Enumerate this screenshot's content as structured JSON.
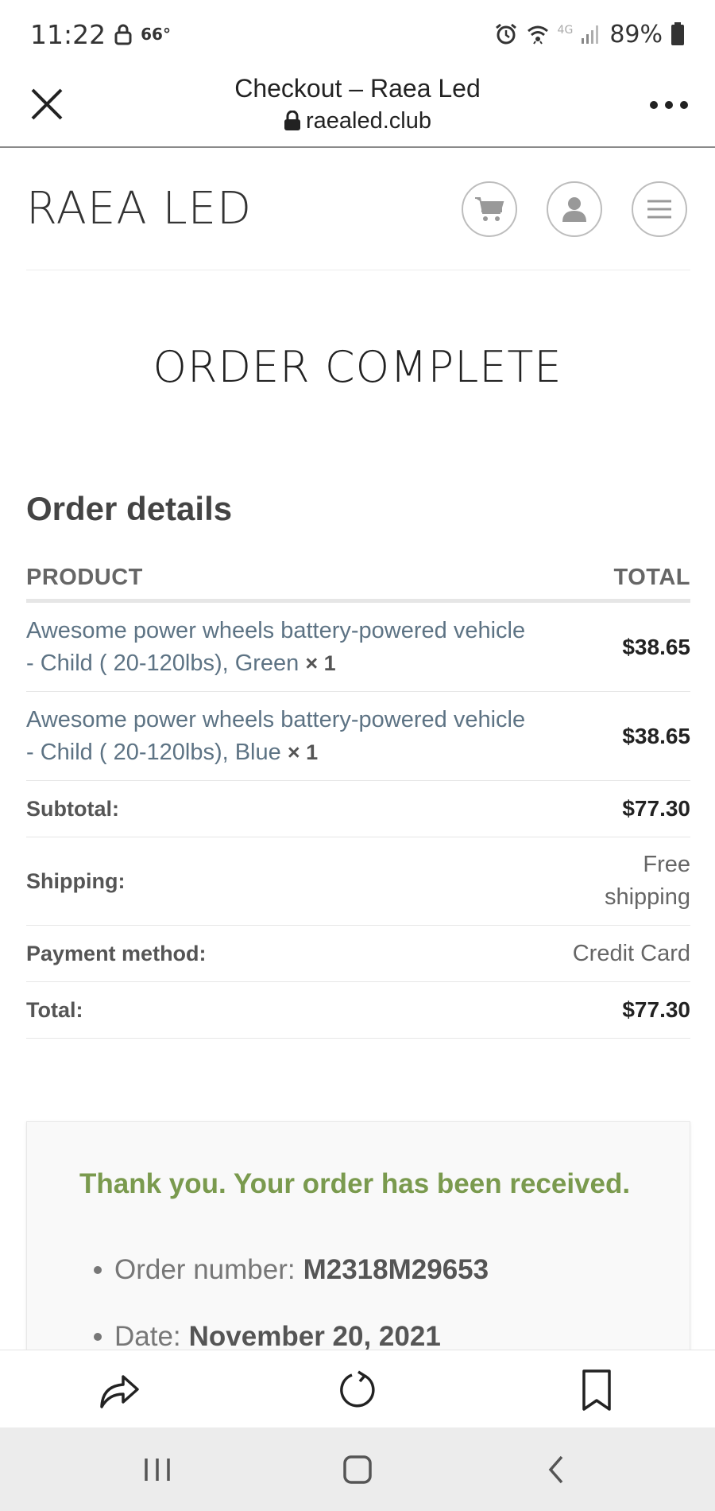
{
  "status_bar": {
    "time": "11:22",
    "temperature": "66°",
    "network": "4G",
    "battery": "89%"
  },
  "browser": {
    "title": "Checkout – Raea Led",
    "url": "raealed.club"
  },
  "site": {
    "logo": "RAEA LED"
  },
  "page": {
    "title": "ORDER COMPLETE",
    "section_title": "Order details"
  },
  "table": {
    "headers": {
      "product": "PRODUCT",
      "total": "TOTAL"
    },
    "items": [
      {
        "name": "Awesome power wheels battery-powered vehicle - Child ( 20-120lbs), Green",
        "qty": "× 1",
        "total": "$38.65"
      },
      {
        "name": "Awesome power wheels battery-powered vehicle - Child ( 20-120lbs), Blue",
        "qty": "× 1",
        "total": "$38.65"
      }
    ],
    "summary": {
      "subtotal_label": "Subtotal:",
      "subtotal_value": "$77.30",
      "shipping_label": "Shipping:",
      "shipping_value": "Free shipping",
      "payment_label": "Payment method:",
      "payment_value": "Credit Card",
      "total_label": "Total:",
      "total_value": "$77.30"
    }
  },
  "confirmation": {
    "thanks": "Thank you. Your order has been received.",
    "order_number_label": "Order number:",
    "order_number": "M2318M29653",
    "date_label": "Date:",
    "date": "November 20, 2021"
  },
  "colors": {
    "link": "#5d7384",
    "success": "#7a9a4e",
    "divider": "#e6e6e6"
  }
}
